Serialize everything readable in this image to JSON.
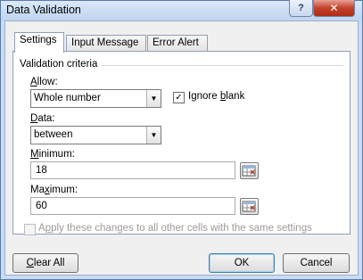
{
  "window": {
    "title": "Data Validation",
    "help_label": "?",
    "close_label": "✕"
  },
  "tabs": [
    {
      "label": "Settings",
      "active": true
    },
    {
      "label": "Input Message",
      "active": false
    },
    {
      "label": "Error Alert",
      "active": false
    }
  ],
  "settings": {
    "section_title": "Validation criteria",
    "allow": {
      "label_first": "A",
      "label_rest": "llow:",
      "value": "Whole number"
    },
    "ignore_blank": {
      "label_pre": "Ignore ",
      "label_u": "b",
      "label_post": "lank",
      "checked": true,
      "mark": "✓"
    },
    "data": {
      "label_first": "D",
      "label_rest": "ata:",
      "value": "between"
    },
    "minimum": {
      "label_pre": "",
      "label_u": "M",
      "label_post": "inimum:",
      "value": "18"
    },
    "maximum": {
      "label_pre": "Ma",
      "label_u": "x",
      "label_post": "imum:",
      "value": "60"
    },
    "apply_all": {
      "label_pre": "A",
      "label_u": "p",
      "label_post": "ply these changes to all other cells with the same settings",
      "checked": false,
      "enabled": false
    }
  },
  "buttons": {
    "clear_all_u": "C",
    "clear_all_rest": "lear All",
    "ok": "OK",
    "cancel": "Cancel"
  },
  "icons": {
    "dropdown": "▼"
  }
}
